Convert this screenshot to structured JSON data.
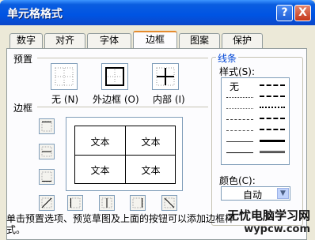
{
  "title": "单元格格式",
  "title_buttons": {
    "help": "?",
    "close": "X"
  },
  "tabs": [
    "数字",
    "对齐",
    "字体",
    "边框",
    "图案",
    "保护"
  ],
  "active_tab": "边框",
  "presets": {
    "heading": "预置",
    "items": [
      {
        "label": "无 (N)",
        "icon": "no-border-icon"
      },
      {
        "label": "外边框 (O)",
        "icon": "outline-border-icon"
      },
      {
        "label": "内部 (I)",
        "icon": "inside-border-icon"
      }
    ]
  },
  "border": {
    "heading": "边框"
  },
  "preview_cells": [
    "文本",
    "文本",
    "文本",
    "文本"
  ],
  "line": {
    "heading": "线条",
    "style_label": "样式(S):",
    "none_label": "无"
  },
  "color": {
    "label": "颜色(C):",
    "value": "自动"
  },
  "footer_text": "单击预置选项、预览草图及上面的按钮可以添加边框样式。",
  "watermark": {
    "line1": "无忧电脑学习网",
    "line2": "wypcw.com"
  }
}
